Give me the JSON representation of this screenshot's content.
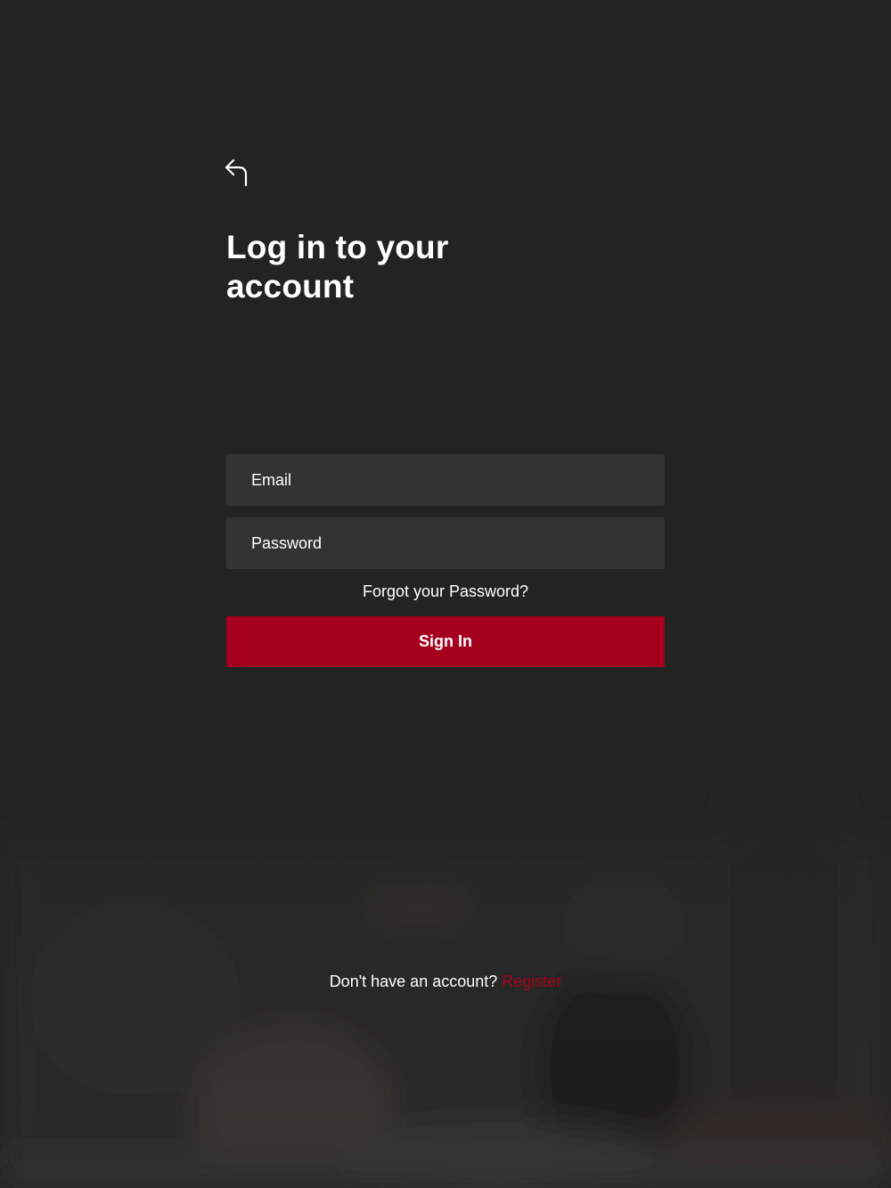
{
  "header": {
    "back_icon": "back-arrow-icon",
    "title": "Log in to your account"
  },
  "form": {
    "email_placeholder": "Email",
    "password_placeholder": "Password",
    "forgot_password": "Forgot your Password?",
    "sign_in_label": "Sign In"
  },
  "footer": {
    "prompt": "Don't have an account?",
    "register_label": "Register"
  },
  "colors": {
    "background": "#232323",
    "field_background": "#333333",
    "accent": "#a5001d",
    "text": "#ffffff"
  }
}
